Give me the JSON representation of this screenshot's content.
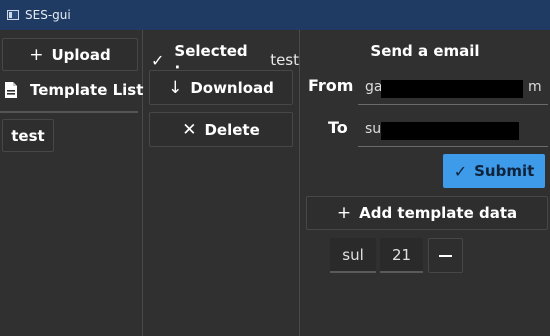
{
  "window": {
    "title": "SES-gui"
  },
  "left": {
    "upload_label": "Upload",
    "template_list_label": "Template List",
    "templates": [
      {
        "label": "test"
      }
    ]
  },
  "middle": {
    "selected_label": "Selected :",
    "selected_value": "test",
    "download_label": "Download",
    "delete_label": "Delete"
  },
  "right": {
    "heading": "Send a email",
    "from_label": "From",
    "from_value_visible_start": "ga",
    "from_value_visible_end": "m",
    "to_label": "To",
    "to_value_visible_start": "su",
    "submit_label": "Submit",
    "add_template_data_label": "Add template data",
    "template_data": [
      {
        "key": "sul",
        "value": "21"
      }
    ]
  },
  "colors": {
    "accent": "#3d9be9",
    "titlebar": "#1f3b63",
    "background": "#303030"
  },
  "icons": {
    "upload": "plus-icon",
    "template_list": "document-icon",
    "selected": "check-icon",
    "download": "arrow-down-icon",
    "delete": "close-icon",
    "submit": "check-icon",
    "add": "plus-icon",
    "remove": "minus-icon"
  }
}
